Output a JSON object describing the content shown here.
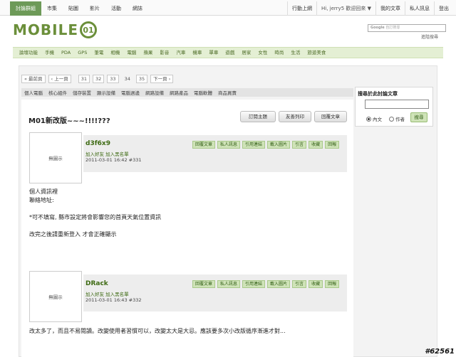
{
  "topnav": [
    "討論群組",
    "市集",
    "貼圖",
    "影片",
    "活動",
    "網誌"
  ],
  "topright": {
    "mobile": "行動上網",
    "greeting": "Hi, jerry5 歡迎回來 ▼",
    "my_articles": "我的文章",
    "private_msg": "私人訊息",
    "logout": "登出"
  },
  "logo": {
    "text": "MOBILE",
    "mark": "01"
  },
  "search": {
    "brand": "Google",
    "placeholder": "自訂搜尋",
    "advanced": "進階搜尋"
  },
  "categories": [
    "論壇功能",
    "手機",
    "PDA",
    "GPS",
    "筆電",
    "相機",
    "電腦",
    "蘋果",
    "影音",
    "汽車",
    "機車",
    "單車",
    "遊戲",
    "居家",
    "女性",
    "時尚",
    "生活",
    "旅遊美食"
  ],
  "pager": {
    "first": "« 最前頁",
    "prev": "‹ 上一頁",
    "pages": [
      "31",
      "32",
      "33",
      "34",
      "35"
    ],
    "current": "34",
    "next": "下一頁 ›"
  },
  "subcats": [
    "個人電腦",
    "核心組件",
    "儲存裝置",
    "顯示設備",
    "電腦週邊",
    "網路設備",
    "網路產品",
    "電腦軟體",
    "商品買賣"
  ],
  "thread": {
    "title": "M01新改版~~~!!!!???",
    "btn_new": "訂閱主題",
    "btn_print": "友善列印",
    "btn_reply": "回覆文章"
  },
  "no_image": "無圖示",
  "post_actions": [
    "回覆文章",
    "私人訊息",
    "引用連結",
    "載入圖片",
    "引言",
    "收藏",
    "回報"
  ],
  "posts": [
    {
      "username": "d3f6x9",
      "links": "加入好友  加入黑名單",
      "date": "2011-03-01 16:42  #331",
      "lines": [
        "個人資訊裡",
        "聯絡地址:",
        "",
        "*可不填寫, 縣市設定將會影響您的首頁天氣位置資訊",
        "",
        "改完之後請重新登入 才會正確顯示"
      ]
    },
    {
      "username": "DRack",
      "links": "加入好友  加入黑名單",
      "date": "2011-03-01 16:43  #332",
      "lines": [
        "改太多了，而且不易閱讀。改變使用者習慣可以，改變太大是大忌。應該要多次小改版循序漸進才對..."
      ]
    }
  ],
  "sidebar": {
    "title": "搜尋於此討論文章",
    "opt_content": "內文",
    "opt_author": "作者",
    "btn": "搜尋"
  },
  "watermark": "#62561"
}
